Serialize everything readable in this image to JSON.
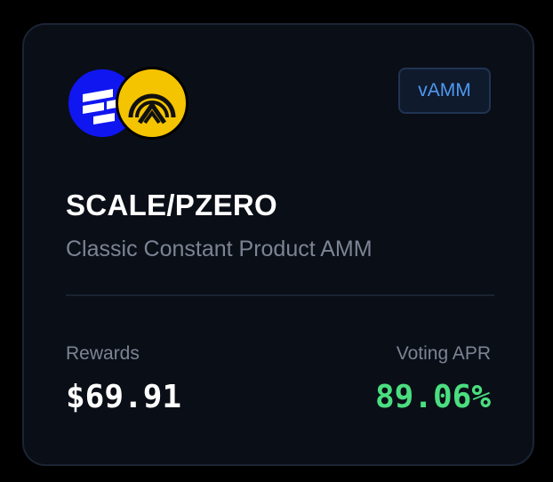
{
  "pool": {
    "badge": "vAMM",
    "title": "SCALE/PZERO",
    "subtitle": "Classic Constant Product AMM",
    "tokens": [
      {
        "name": "SCALE",
        "icon": "scale-token-icon",
        "color": "#1016f0"
      },
      {
        "name": "PZERO",
        "icon": "pzero-token-icon",
        "color": "#f5c400"
      }
    ]
  },
  "stats": {
    "rewards_label": "Rewards",
    "rewards_value": "$69.91",
    "apr_label": "Voting APR",
    "apr_value": "89.06%"
  },
  "colors": {
    "background": "#000000",
    "card": "#0a0e17",
    "accent_blue": "#4f98f0",
    "apr_green": "#4ade80",
    "muted_text": "#7c8493"
  }
}
